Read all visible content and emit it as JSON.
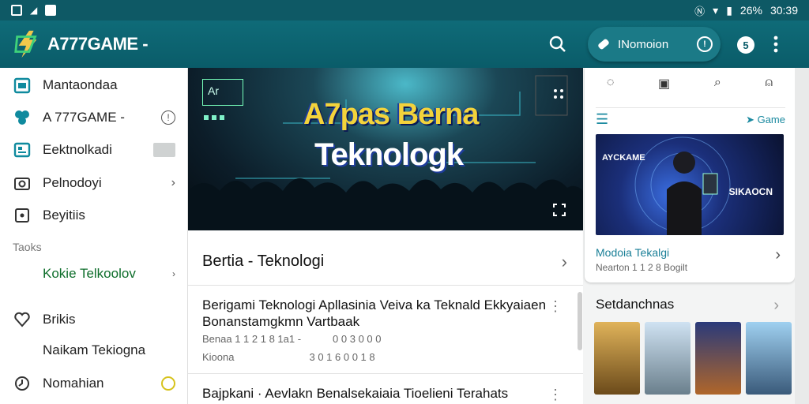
{
  "status_bar": {
    "battery": "26%",
    "time": "30:39"
  },
  "app": {
    "brand": "A777GAME -",
    "notification_label": "INomoion",
    "avatar_badge": "5"
  },
  "sidebar": {
    "items": [
      {
        "label": "Mantaondaa"
      },
      {
        "label": "A 777GAME -"
      },
      {
        "label": "Eektnolkadi"
      },
      {
        "label": "Pelnodoyi"
      },
      {
        "label": "Beyitiis"
      }
    ],
    "section_label": "Taoks",
    "sub_item": "Kokie Telkoolov",
    "items2": [
      {
        "label": "Brikis"
      },
      {
        "label": "Naikam Tekiogna"
      },
      {
        "label": "Nomahian"
      }
    ]
  },
  "hero": {
    "tag": "Ar",
    "title_line1": "A7pas Berna",
    "title_line2": "Teknologk"
  },
  "feed": {
    "header": "Bertia - Teknologi",
    "articles": [
      {
        "title": "Berigami Teknologi  Apllasinia Veiva ka Teknald Ekkyaiaen Bonanstamgkmn Vartbaak",
        "meta1": "Benaa 1 1 2 1 8 1a1  -",
        "meta2": "0 0 3 0 0 0",
        "meta3": "Kioona",
        "meta4": "3 0 1 6 0 0 1 8"
      },
      {
        "title": "Bajpkani · Aevlakn Benalsekaiaia Tioelieni Terahats"
      }
    ]
  },
  "right_panel": {
    "game_link": "Game",
    "image_left": "AYCKAME",
    "image_right": "SIKAOCN",
    "caption": "Modoia Tekalgi",
    "subcaption": "Nearton 1 1 2 8 Bogilt",
    "section": "Setdanchnas"
  },
  "colors": {
    "accent": "#0f6b78",
    "link": "#1b8aa0",
    "hero_gold": "#f3d33b"
  }
}
